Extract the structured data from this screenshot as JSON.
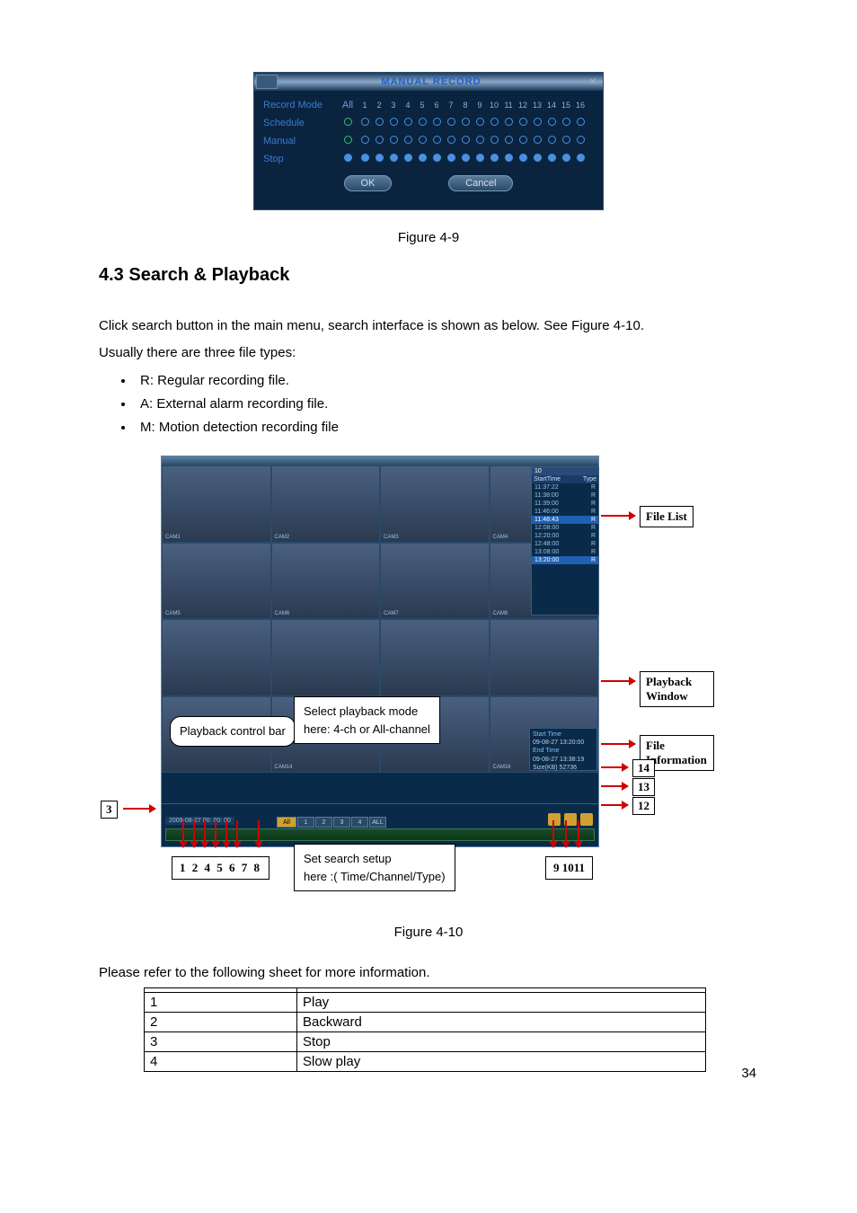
{
  "manual_record": {
    "title": "MANUAL RECORD",
    "col_label": "Record Mode",
    "all_label": "All",
    "channels": [
      "1",
      "2",
      "3",
      "4",
      "5",
      "6",
      "7",
      "8",
      "9",
      "10",
      "11",
      "12",
      "13",
      "14",
      "15",
      "16"
    ],
    "rows": {
      "schedule": "Schedule",
      "manual": "Manual",
      "stop": "Stop"
    },
    "ok": "OK",
    "cancel": "Cancel"
  },
  "fig49": "Figure 4-9",
  "section": "4.3  Search & Playback",
  "para1": "Click search button in the main menu, search interface is shown as below. See Figure 4-10.",
  "para2": "Usually there are three file types:",
  "bullets": {
    "r": "R: Regular recording file.",
    "a": "A: External alarm recording file.",
    "m": "M: Motion detection recording file"
  },
  "figure410": {
    "filelist": {
      "header_a": "StartTime",
      "header_b": "Type",
      "count": "10",
      "rows": [
        {
          "t": "11:37:22",
          "p": "R",
          "sel": false
        },
        {
          "t": "11:38:00",
          "p": "R",
          "sel": false
        },
        {
          "t": "11:39:00",
          "p": "R",
          "sel": false
        },
        {
          "t": "11:46:00",
          "p": "R",
          "sel": false
        },
        {
          "t": "11:48:43",
          "p": "R",
          "sel": true
        },
        {
          "t": "12:08:00",
          "p": "R",
          "sel": false
        },
        {
          "t": "12:20:00",
          "p": "R",
          "sel": false
        },
        {
          "t": "12:48:00",
          "p": "R",
          "sel": false
        },
        {
          "t": "13:08:00",
          "p": "R",
          "sel": false
        },
        {
          "t": "13:20:00",
          "p": "R",
          "sel": true
        }
      ]
    },
    "fileinfo": {
      "l1": "Start Time",
      "v1": "09-08-27 13:20:00",
      "l2": "End Time",
      "v2": "09-08-27 13:38:19",
      "l3": "Size(KB)  52736"
    },
    "cams": [
      "CAM1",
      "CAM2",
      "CAM3",
      "CAM4",
      "CAM5",
      "CAM6",
      "CAM7",
      "CAM8",
      "",
      "",
      "",
      "",
      "",
      "CAM14",
      "",
      "CAM16"
    ],
    "date": "2009-08-27 00: 00: 00",
    "chips": [
      "All",
      "1",
      "2",
      "3",
      "4",
      "ALL"
    ],
    "labels": {
      "playback_ctrl": "Playback control bar",
      "select_mode_a": "Select playback mode",
      "select_mode_b": "here: 4-ch or All-channel",
      "set_search_a": "Set search setup",
      "set_search_b": "here :( Time/Channel/Type)",
      "filelist": "File List",
      "playback_window": "Playback Window",
      "fileinfo": "File Information",
      "n3": "3",
      "n12": "12",
      "n13": "13",
      "n14": "14",
      "nums_a": "1 2 4 5 6 7  8",
      "nums_b": "9 1011"
    }
  },
  "fig410_caption": "Figure 4-10",
  "sheet_note": "Please refer to the following sheet for more information.",
  "table": {
    "rows": [
      {
        "n": "1",
        "v": "Play"
      },
      {
        "n": "2",
        "v": "Backward"
      },
      {
        "n": "3",
        "v": "Stop"
      },
      {
        "n": "4",
        "v": "Slow play"
      }
    ]
  },
  "page": "34"
}
